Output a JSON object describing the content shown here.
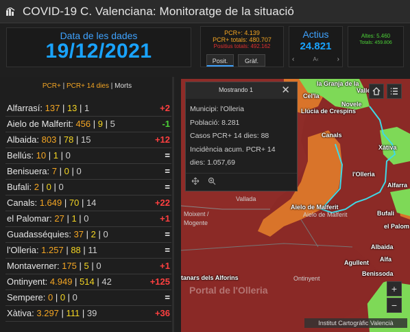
{
  "header": {
    "title": "COVID-19 C. Valenciana: Monitoratge de la situació",
    "logo_icon": "dashboard-logo-icon"
  },
  "date_panel": {
    "label": "Data de les dades",
    "value": "19/12/2021"
  },
  "pcr_panel": {
    "pcr": "PCR+: 4.139",
    "pcr_total": "PCR+ totals: 480.707",
    "positius_total": "Positius totals: 492.162",
    "tab_posit": "Posit.",
    "tab_graf": "Gràf."
  },
  "actius_panel": {
    "label": "Actius",
    "value": "24.821",
    "nav_prev": "‹",
    "nav_mid": "A‹",
    "nav_next": "›"
  },
  "altes_panel": {
    "altes": "Altes: 5.460",
    "totals": "Totals: 459.806"
  },
  "list": {
    "header_a": "PCR+",
    "header_sep": " | ",
    "header_b": "PCR+ 14 dies",
    "header_sep2": " | ",
    "header_c": "Morts",
    "rows": [
      {
        "name": "Alfarrasí",
        "cases": "137",
        "pcr14": "13",
        "deaths": "1",
        "trend": "+2",
        "trend_type": "up"
      },
      {
        "name": "Aielo de Malferit",
        "cases": "456",
        "pcr14": "9",
        "deaths": "5",
        "trend": "-1",
        "trend_type": "down"
      },
      {
        "name": "Albaida",
        "cases": "803",
        "pcr14": "78",
        "deaths": "15",
        "trend": "+12",
        "trend_type": "up"
      },
      {
        "name": "Bellús",
        "cases": "10",
        "pcr14": "1",
        "deaths": "0",
        "trend": "=",
        "trend_type": "eq"
      },
      {
        "name": "Benisuera",
        "cases": "7",
        "pcr14": "0",
        "deaths": "0",
        "trend": "=",
        "trend_type": "eq"
      },
      {
        "name": "Bufali",
        "cases": "2",
        "pcr14": "0",
        "deaths": "0",
        "trend": "=",
        "trend_type": "eq"
      },
      {
        "name": "Canals",
        "cases": "1.649",
        "pcr14": "70",
        "deaths": "14",
        "trend": "+22",
        "trend_type": "up"
      },
      {
        "name": "el Palomar",
        "cases": "27",
        "pcr14": "1",
        "deaths": "0",
        "trend": "+1",
        "trend_type": "up"
      },
      {
        "name": "Guadasséquies",
        "cases": "37",
        "pcr14": "2",
        "deaths": "0",
        "trend": "=",
        "trend_type": "eq"
      },
      {
        "name": "l'Olleria",
        "cases": "1.257",
        "pcr14": "88",
        "deaths": "11",
        "trend": "=",
        "trend_type": "eq"
      },
      {
        "name": "Montaverner",
        "cases": "175",
        "pcr14": "5",
        "deaths": "0",
        "trend": "+1",
        "trend_type": "up"
      },
      {
        "name": "Ontinyent",
        "cases": "4.949",
        "pcr14": "514",
        "deaths": "42",
        "trend": "+125",
        "trend_type": "up"
      },
      {
        "name": "Sempere",
        "cases": "0",
        "pcr14": "0",
        "deaths": "0",
        "trend": "=",
        "trend_type": "eq"
      },
      {
        "name": "Xàtiva",
        "cases": "3.297",
        "pcr14": "111",
        "deaths": "39",
        "trend": "+36",
        "trend_type": "up"
      }
    ]
  },
  "popup": {
    "title": "Mostrando 1",
    "close": "✕",
    "municipi": "Municipi: l'Olleria",
    "poblacio": "Població: 8.281",
    "casos": "Casos PCR+ 14 dies: 88",
    "incidencia_1": "Incidència acum. PCR+ 14",
    "incidencia_2": "dies: 1.057,69"
  },
  "map": {
    "labels": {
      "granja": "la Granja de la",
      "granja2": "Vallés",
      "celia": "Cel'la",
      "novele": "Novele",
      "llucia": "Llúcia de Crespins",
      "canals": "Canals",
      "xativa": "Xàtiva",
      "olleria": "l'Olleria",
      "alfarra": "Alfarra",
      "valiada": "Vallada",
      "aielo_a": "Aielo de Malferit",
      "aielo_b": "Aielo de Malferit",
      "bufali": "Bufali",
      "moixent": "Moixent /",
      "mogente": "Mogente",
      "elpalom": "el Palom",
      "albaida": "Albaida",
      "agullent": "Agullent",
      "benissoda": "Benissoda",
      "ontinyent": "Ontinyent",
      "fontanars": "tanars dels Alforins",
      "alfarras2": "Alfa",
      "portal": "Portal de l'Olleria"
    },
    "zoom_in": "+",
    "zoom_out": "−",
    "attribution": "Institut Cartogràfic Valencià"
  }
}
